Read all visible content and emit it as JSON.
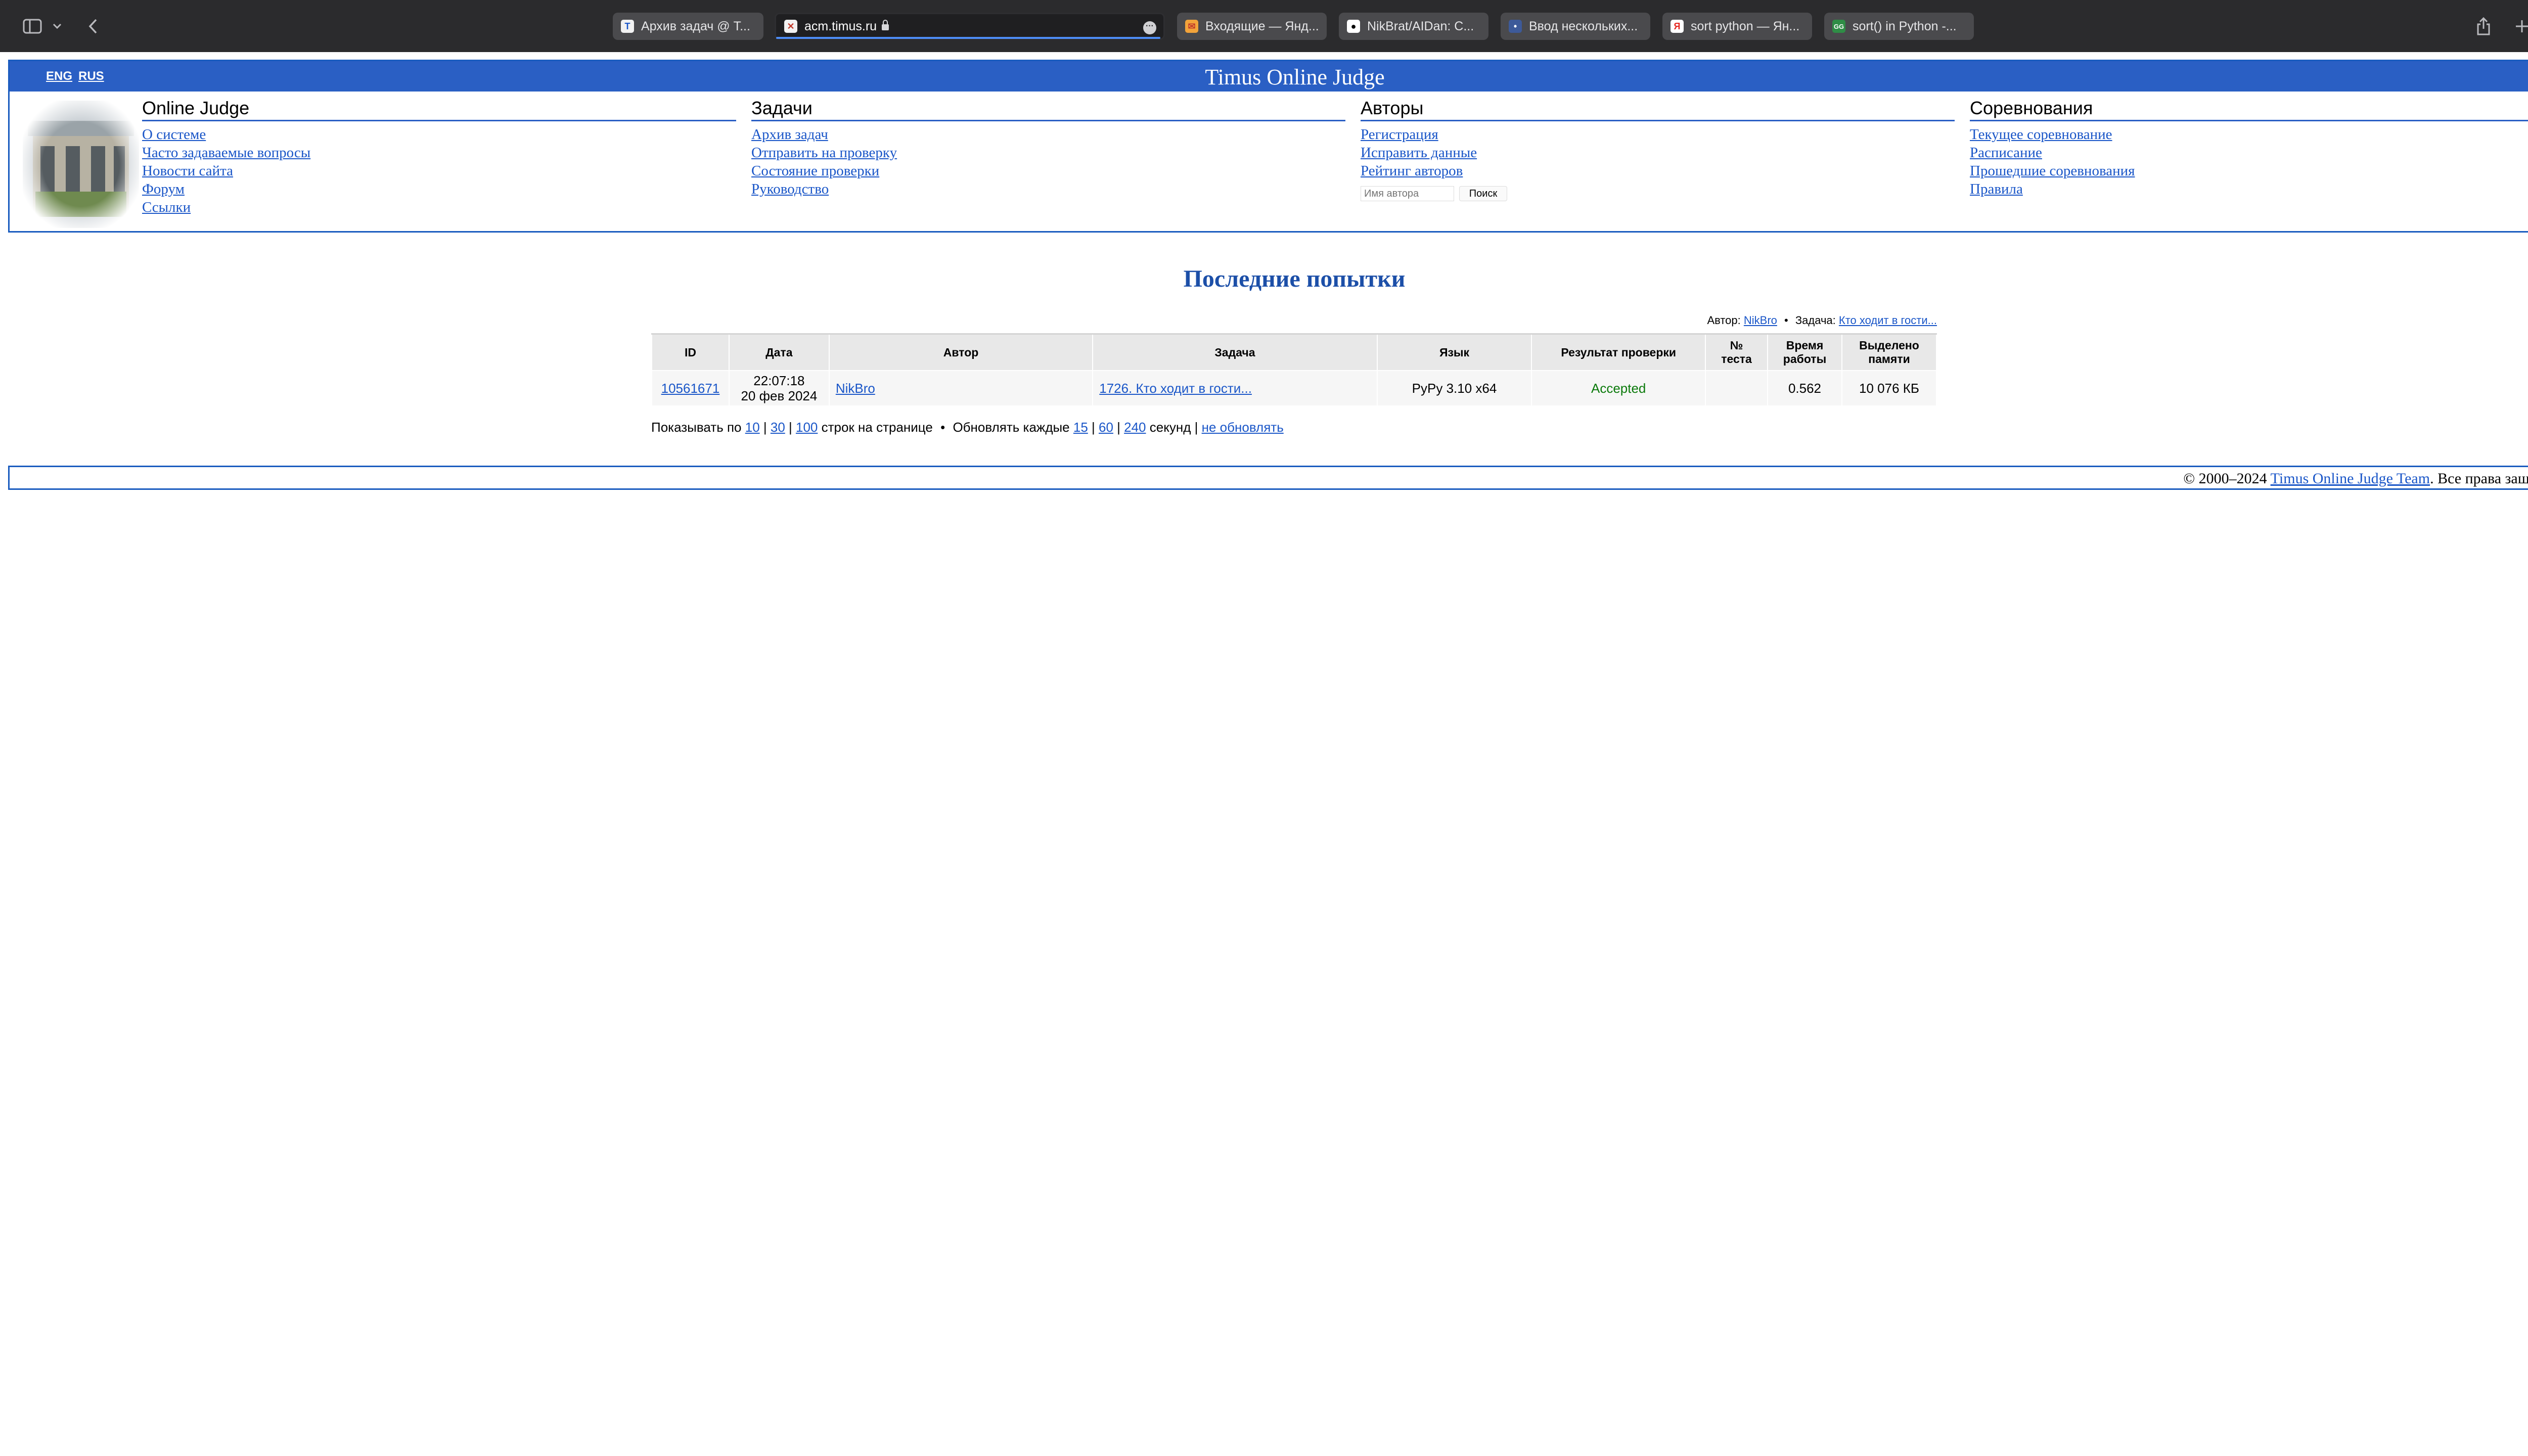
{
  "browser": {
    "tabs": [
      {
        "title": "Архив задач @ T...",
        "favicon": "timus-favicon"
      },
      {
        "title": "acm.timus.ru",
        "favicon": "timus-favicon",
        "active": true
      },
      {
        "title": "Входящие — Янд...",
        "favicon": "mail-favicon"
      },
      {
        "title": "NikBrat/AIDan: C...",
        "favicon": "github-favicon"
      },
      {
        "title": "Ввод нескольких...",
        "favicon": "forum-favicon"
      },
      {
        "title": "sort python — Ян...",
        "favicon": "yandex-favicon"
      },
      {
        "title": "sort() in Python -...",
        "favicon": "gfg-favicon"
      }
    ]
  },
  "header": {
    "lang_eng": "ENG",
    "lang_rus": "RUS",
    "site_title": "Timus Online Judge",
    "columns": [
      {
        "heading": "Online Judge",
        "links": [
          "О системе",
          "Часто задаваемые вопросы",
          "Новости сайта",
          "Форум",
          "Ссылки"
        ]
      },
      {
        "heading": "Задачи",
        "links": [
          "Архив задач",
          "Отправить на проверку",
          "Состояние проверки",
          "Руководство"
        ]
      },
      {
        "heading": "Авторы",
        "links": [
          "Регистрация",
          "Исправить данные",
          "Рейтинг авторов"
        ]
      },
      {
        "heading": "Соревнования",
        "links": [
          "Текущее соревнование",
          "Расписание",
          "Прошедшие соревнования",
          "Правила"
        ]
      }
    ],
    "author_search": {
      "placeholder": "Имя автора",
      "button": "Поиск"
    }
  },
  "main": {
    "heading": "Последние попытки",
    "filter": {
      "author_label": "Автор:",
      "author": "NikBro",
      "separator": "•",
      "problem_label": "Задача:",
      "problem": "Кто ходит в гости..."
    },
    "table": {
      "headers": [
        "ID",
        "Дата",
        "Автор",
        "Задача",
        "Язык",
        "Результат проверки",
        "№ теста",
        "Время работы",
        "Выделено памяти"
      ],
      "rows": [
        {
          "id": "10561671",
          "time": "22:07:18",
          "date": "20 фев 2024",
          "author": "NikBro",
          "problem": "1726. Кто ходит в гости...",
          "language": "PyPy 3.10 x64",
          "verdict": "Accepted",
          "test": "",
          "run_time": "0.562",
          "memory": "10 076 КБ"
        }
      ]
    },
    "pager": {
      "show_label": "Показывать по",
      "counts": [
        "10",
        "30",
        "100"
      ],
      "rows_label": "строк на странице",
      "bullet": "•",
      "refresh_label": "Обновлять каждые",
      "intervals": [
        "15",
        "60",
        "240"
      ],
      "seconds_label": "секунд",
      "no_refresh": "не обновлять"
    }
  },
  "footer": {
    "copyright": "© 2000–2024",
    "team_link": "Timus Online Judge Team",
    "rights": ". Все права защищены."
  },
  "colors": {
    "header_blue": "#2a5fc4",
    "link": "#1a56c8",
    "heading": "#1c4fa8",
    "accepted": "#0b7a0b"
  }
}
